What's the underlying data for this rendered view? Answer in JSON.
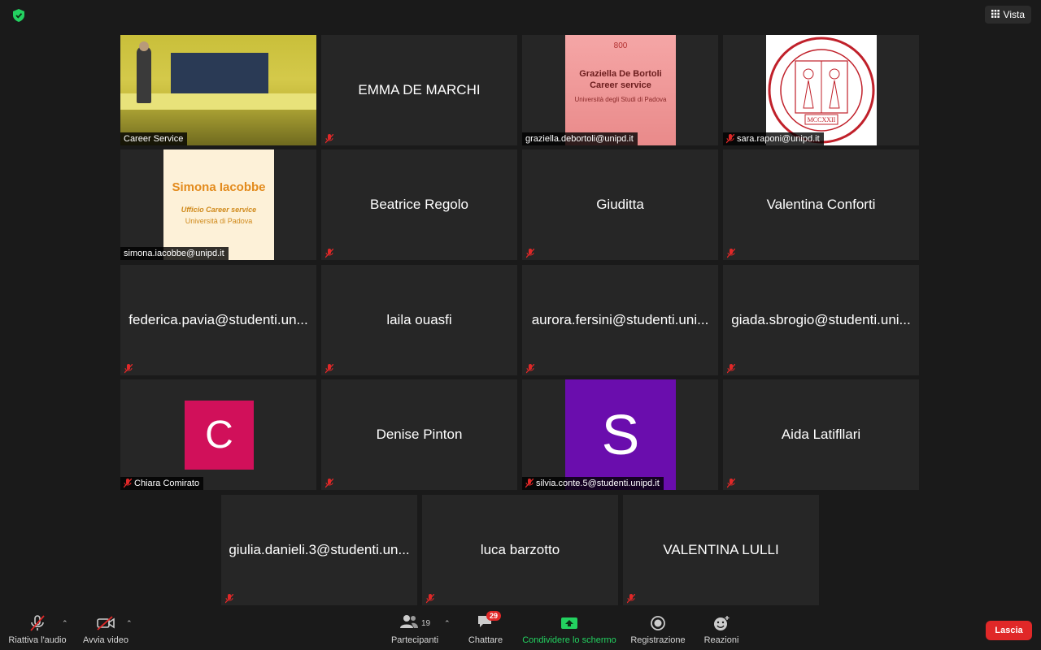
{
  "top": {
    "view_label": "Vista"
  },
  "tiles": {
    "career_service": {
      "name": "Career Service"
    },
    "emma": {
      "name": "EMMA DE MARCHI"
    },
    "graziella": {
      "label": "graziella.debortoli@unipd.it",
      "slide_line1": "Graziella De Bortoli",
      "slide_line2": "Career service",
      "slide_line3": "Università degli Studi di Padova",
      "slide_logo": "800"
    },
    "sara": {
      "label": "sara.raponi@unipd.it",
      "seal_text": "MCCXXII"
    },
    "simona": {
      "label": "simona.iacobbe@unipd.it",
      "slide_name": "Simona Iacobbe",
      "slide_office": "Ufficio Career service",
      "slide_univ": "Università di Padova"
    },
    "beatrice": {
      "name": "Beatrice Regolo"
    },
    "giuditta": {
      "name": "Giuditta"
    },
    "valentina_c": {
      "name": "Valentina Conforti"
    },
    "federica": {
      "name": "federica.pavia@studenti.un..."
    },
    "laila": {
      "name": "laila ouasfi"
    },
    "aurora": {
      "name": "aurora.fersini@studenti.uni..."
    },
    "giada": {
      "name": "giada.sbrogio@studenti.uni..."
    },
    "chiara": {
      "label": "Chiara Comirato",
      "initial": "C",
      "color": "#d1105a"
    },
    "denise": {
      "name": "Denise Pinton"
    },
    "silvia": {
      "label": "silvia.conte.5@studenti.unipd.it",
      "initial": "S",
      "color": "#6a0dad"
    },
    "aida": {
      "name": "Aida Latifllari"
    },
    "giulia": {
      "name": "giulia.danieli.3@studenti.un..."
    },
    "luca": {
      "name": "luca barzotto"
    },
    "valentina_l": {
      "name": "VALENTINA LULLI"
    }
  },
  "toolbar": {
    "audio_label": "Riattiva l'audio",
    "video_label": "Avvia video",
    "participants_label": "Partecipanti",
    "participants_count": "19",
    "chat_label": "Chattare",
    "chat_badge": "29",
    "share_label": "Condividere lo schermo",
    "record_label": "Registrazione",
    "reactions_label": "Reazioni",
    "leave_label": "Lascia"
  },
  "colors": {
    "accent_green": "#23d160",
    "leave_red": "#e02828",
    "active_speaker": "#c8e05a"
  }
}
